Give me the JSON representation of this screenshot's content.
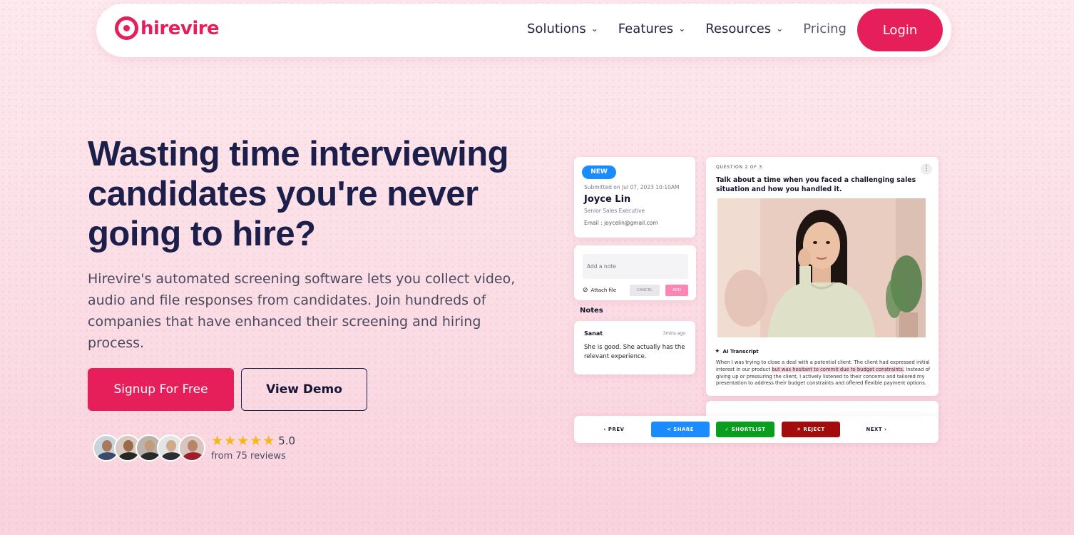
{
  "navbar": {
    "logo_text": "hirevire",
    "links": [
      {
        "label": "Solutions",
        "has_dropdown": true
      },
      {
        "label": "Features",
        "has_dropdown": true
      },
      {
        "label": "Resources",
        "has_dropdown": true
      },
      {
        "label": "Pricing",
        "has_dropdown": false
      }
    ],
    "login_label": "Login"
  },
  "hero": {
    "headline": "Wasting time interviewing candidates you're never going to hire?",
    "subtext": "Hirevire's automated screening software lets you collect video, audio and file responses from candidates. Join hundreds of companies that have enhanced their screening and hiring process.",
    "signup_label": "Signup For Free",
    "demo_label": "View Demo",
    "rating": {
      "stars": 5,
      "value": "5.0",
      "count_text": "from 75 reviews"
    }
  },
  "mockup": {
    "profile": {
      "badge": "NEW",
      "submitted": "Submitted on Jul 07, 2023 10:10AM",
      "name": "Joyce Lin",
      "role": "Senior Sales Executive",
      "email": "Email     : joycelin@gmail.com"
    },
    "note_form": {
      "placeholder": "Add a note",
      "attach_label": "Attach file",
      "cancel_label": "CANCEL",
      "add_label": "ADD"
    },
    "notes": {
      "heading": "Notes",
      "author": "Sanat",
      "time": "3mins ago",
      "text": "She is good. She actually has the relevant experience."
    },
    "question": {
      "label": "QUESTION 2 OF 3",
      "menu_icon": "⋮",
      "text": "Talk about a time when you faced a challenging sales situation and how you handled it.",
      "ai_label": "AI Transcript",
      "transcript_before": "When I was trying to close a deal with a potential client. The client had expressed initial interest in our product ",
      "transcript_highlight": "but was hesitant to commit due to budget constraints.",
      "transcript_after": " Instead of giving up or pressuring the client, I actively listened to their concerns and tailored my presentation to address their budget constraints and offered flexible payment options."
    },
    "actions": {
      "prev": "‹ PREV",
      "share": "< SHARE",
      "shortlist": "✓ SHORTLIST",
      "reject": "✕ REJECT",
      "next": "NEXT ›"
    }
  },
  "colors": {
    "brand": "#e61e5a",
    "navy": "#1d1f4b",
    "share": "#1a8cff",
    "shortlist": "#0a9e1e",
    "reject": "#a30c0c",
    "star": "#f5b81c"
  }
}
